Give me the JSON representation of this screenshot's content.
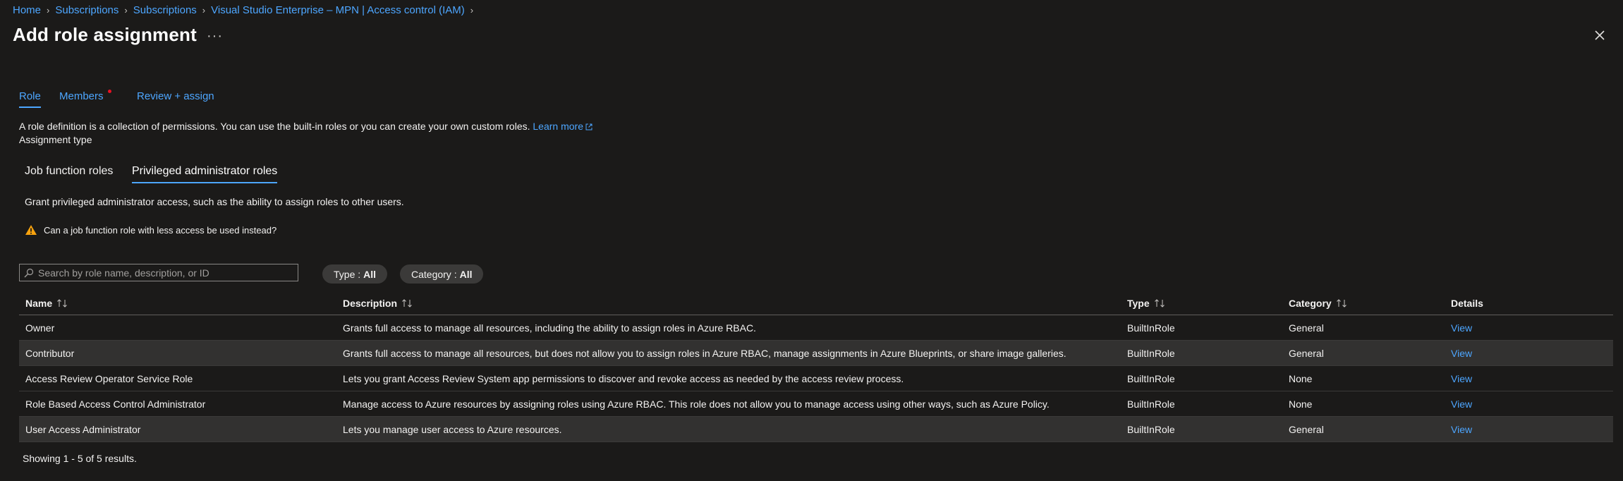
{
  "breadcrumb": [
    "Home",
    "Subscriptions",
    "Subscriptions",
    "Visual Studio Enterprise – MPN | Access control (IAM)"
  ],
  "title": "Add role assignment",
  "more_label": "···",
  "tabs": [
    {
      "label": "Role",
      "active": true
    },
    {
      "label": "Members",
      "active": false,
      "badge": true
    },
    {
      "label": "Review + assign",
      "active": false
    }
  ],
  "intro": {
    "text": "A role definition is a collection of permissions. You can use the built-in roles or you can create your own custom roles.",
    "learn_more": "Learn more"
  },
  "assignment_type_label": "Assignment type",
  "sub_tabs": [
    {
      "label": "Job function roles",
      "active": false
    },
    {
      "label": "Privileged administrator roles",
      "active": true
    }
  ],
  "privileged_description": "Grant privileged administrator access, such as the ability to assign roles to other users.",
  "warning_text": "Can a job function role with less access be used instead?",
  "search": {
    "placeholder": "Search by role name, description, or ID",
    "value": ""
  },
  "filters": [
    {
      "label": "Type :",
      "value": "All"
    },
    {
      "label": "Category :",
      "value": "All"
    }
  ],
  "table": {
    "columns": [
      "Name",
      "Description",
      "Type",
      "Category",
      "Details"
    ],
    "rows": [
      {
        "name": "Owner",
        "description": "Grants full access to manage all resources, including the ability to assign roles in Azure RBAC.",
        "type": "BuiltInRole",
        "category": "General",
        "details": "View",
        "highlighted": false
      },
      {
        "name": "Contributor",
        "description": "Grants full access to manage all resources, but does not allow you to assign roles in Azure RBAC, manage assignments in Azure Blueprints, or share image galleries.",
        "type": "BuiltInRole",
        "category": "General",
        "details": "View",
        "highlighted": true
      },
      {
        "name": "Access Review Operator Service Role",
        "description": "Lets you grant Access Review System app permissions to discover and revoke access as needed by the access review process.",
        "type": "BuiltInRole",
        "category": "None",
        "details": "View",
        "highlighted": false
      },
      {
        "name": "Role Based Access Control Administrator",
        "description": "Manage access to Azure resources by assigning roles using Azure RBAC. This role does not allow you to manage access using other ways, such as Azure Policy.",
        "type": "BuiltInRole",
        "category": "None",
        "details": "View",
        "highlighted": false
      },
      {
        "name": "User Access Administrator",
        "description": "Lets you manage user access to Azure resources.",
        "type": "BuiltInRole",
        "category": "General",
        "details": "View",
        "highlighted": true
      }
    ]
  },
  "results_summary": "Showing 1 - 5 of 5 results.",
  "colors": {
    "accent": "#4da6ff",
    "background": "#1b1a19",
    "highlight_row": "#323130",
    "warning": "#f7a20e",
    "badge": "#e81123"
  }
}
